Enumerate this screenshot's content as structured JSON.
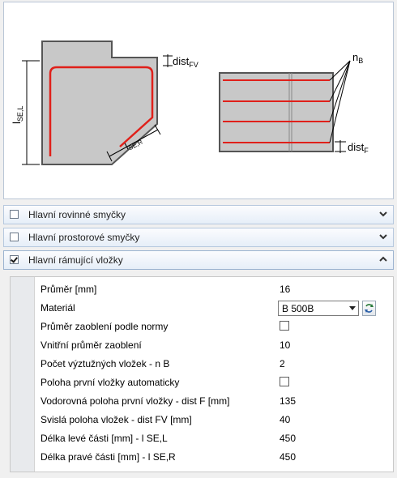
{
  "diagram": {
    "labels": {
      "dist_fv": "dist",
      "dist_fv_sub": "FV",
      "l_sel": "l",
      "l_sel_sub": "SE,L",
      "l_ser": "l",
      "l_ser_sub": "SE,R",
      "n_b": "n",
      "n_b_sub": "B",
      "dist_f": "dist",
      "dist_f_sub": "F"
    },
    "colors": {
      "rebar": "#e0201a",
      "concrete": "#c8c8c8",
      "outline": "#555555"
    }
  },
  "groups": [
    {
      "label": "Hlavní rovinné smyčky",
      "checked": false,
      "chevron": "chevron-down-icon"
    },
    {
      "label": "Hlavní prostorové smyčky",
      "checked": false,
      "chevron": "chevron-down-icon"
    },
    {
      "label": "Hlavní rámující vložky",
      "checked": true,
      "chevron": "chevron-up-icon"
    }
  ],
  "properties": [
    {
      "name": "Průměr [mm]",
      "value": "16"
    },
    {
      "name": "Materiál",
      "value": "B 500B"
    },
    {
      "name": "Průměr zaoblení podle normy",
      "value": "",
      "checked": false
    },
    {
      "name": "Vnitřní průměr zaoblení",
      "value": "10"
    },
    {
      "name": "Počet výztužných vložek - n B",
      "value": "2"
    },
    {
      "name": "Poloha první vložky automaticky",
      "value": "",
      "checked": false
    },
    {
      "name": "Vodorovná poloha první vložky - dist F [mm]",
      "value": "135"
    },
    {
      "name": "Svislá poloha vložek - dist FV [mm]",
      "value": "40"
    },
    {
      "name": "Délka levé části [mm] - l SE,L",
      "value": "450"
    },
    {
      "name": "Délka pravé části [mm] - l SE,R",
      "value": "450"
    }
  ]
}
